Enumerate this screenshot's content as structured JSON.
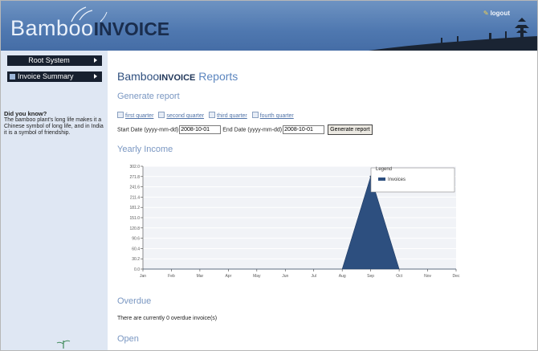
{
  "header": {
    "brand_light": "Bamboo",
    "brand_bold": "INVOICE",
    "logout": "logout"
  },
  "sidebar": {
    "items": [
      {
        "label": "Root System"
      },
      {
        "label": "Invoice Summary"
      }
    ],
    "did_you_know_title": "Did you know?",
    "did_you_know_text": "The bamboo plant's long life makes it a Chinese symbol of long life, and in India it is a symbol of friendship."
  },
  "main": {
    "title_brand_light": "Bamboo",
    "title_brand_bold": "INVOICE",
    "title_rest": " Reports",
    "generate_heading": "Generate report",
    "quarters": [
      "first quarter",
      "second quarter",
      "third quarter",
      "fourth quarter"
    ],
    "start_label": "Start Date (yyyy-mm-dd)",
    "start_value": "2008-10-01",
    "end_label": "End Date (yyyy-mm-dd)",
    "end_value": "2008-10-01",
    "generate_button": "Generate report",
    "yearly_heading": "Yearly Income",
    "overdue_heading": "Overdue",
    "overdue_text": "There are currently 0 overdue invoice(s)",
    "open_heading": "Open"
  },
  "colors": {
    "header": "#4f78b0",
    "sidebar": "#dfe7f3",
    "nav": "#17202f",
    "series": "#2d4f7f"
  },
  "chart_data": {
    "type": "area",
    "categories": [
      "Jan",
      "Feb",
      "Mar",
      "Apr",
      "May",
      "Jun",
      "Jul",
      "Aug",
      "Sep",
      "Oct",
      "Nov",
      "Dec"
    ],
    "yticks": [
      "0.0",
      "30.2",
      "60.4",
      "90.6",
      "120.8",
      "151.0",
      "181.2",
      "211.4",
      "241.6",
      "271.8",
      "302.0"
    ],
    "ylim": [
      0,
      302.0
    ],
    "legend_title": "Legend",
    "legend_position": "top-right",
    "series": [
      {
        "name": "Invoices",
        "values": [
          0,
          0,
          0,
          0,
          0,
          0,
          0,
          0,
          271.8,
          0,
          0,
          0
        ]
      }
    ]
  }
}
